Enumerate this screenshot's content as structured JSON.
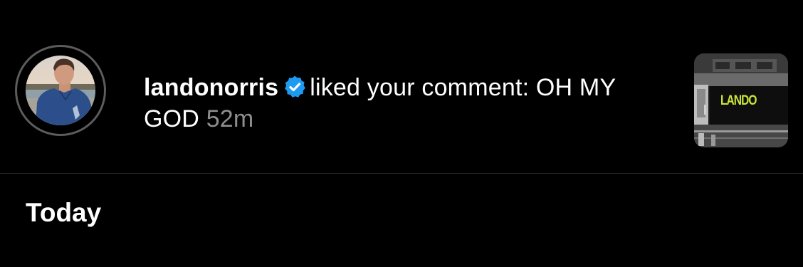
{
  "notification": {
    "username": "landonorris",
    "verified_icon": "verified-badge-icon",
    "message": "liked your comment: OH MY GOD",
    "time": "52m",
    "post_thumbnail_text": "LANDO"
  },
  "section": {
    "heading": "Today"
  },
  "colors": {
    "background": "#000000",
    "text": "#ffffff",
    "muted": "#8e8e8e",
    "verified": "#1d9bf0",
    "thumb_accent": "#cde63a",
    "divider": "#262626"
  }
}
